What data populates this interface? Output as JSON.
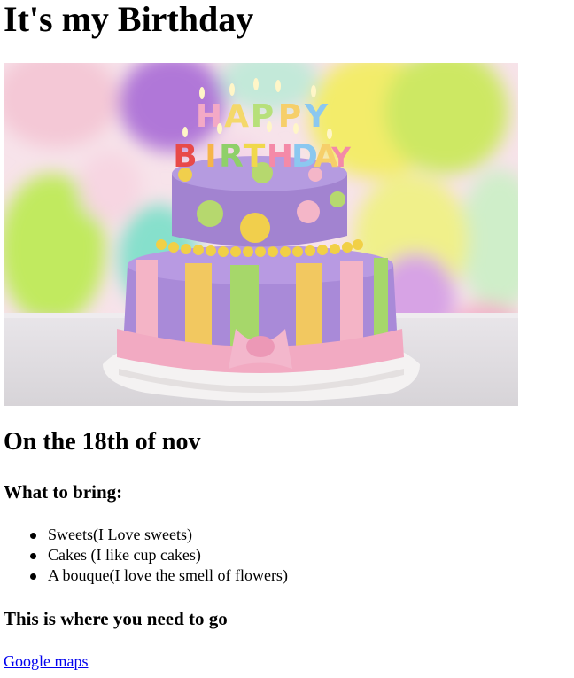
{
  "page": {
    "title": "It's my Birthday",
    "date_heading": "On the 18th of nov",
    "bring_heading": "What to bring:",
    "bring_items": [
      "Sweets(I Love sweets)",
      "Cakes (I like cup cakes)",
      "A bouque(I love the smell of flowers)"
    ],
    "directions_heading": "This is where you need to go",
    "map_link": "Google maps"
  },
  "photo": {
    "subject": "birthday-cake",
    "candle_letters": "HAPPY BIRTHDAY"
  }
}
